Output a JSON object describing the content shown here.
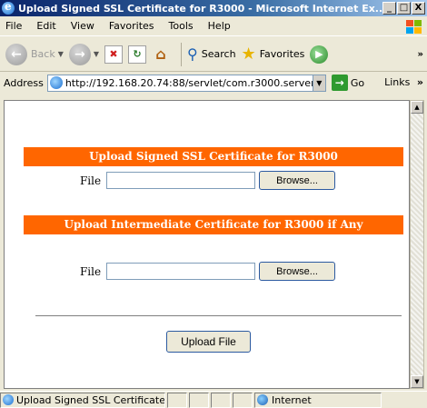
{
  "window": {
    "title": "Upload Signed SSL Certificate for R3000 - Microsoft Internet Ex...",
    "controls": {
      "minimize": "_",
      "maximize": "□",
      "close": "X"
    }
  },
  "menu": [
    "File",
    "Edit",
    "View",
    "Favorites",
    "Tools",
    "Help"
  ],
  "toolbar": {
    "back_label": "Back",
    "search_label": "Search",
    "favorites_label": "Favorites",
    "overflow": "»"
  },
  "address": {
    "label": "Address",
    "url": "http://192.168.20.74:88/servlet/com.r3000.server",
    "go_label": "Go",
    "links_label": "Links",
    "links_chevron": "»"
  },
  "page": {
    "section1_title": "Upload Signed SSL Certificate for R3000",
    "section1_file_label": "File",
    "section1_file_value": "",
    "section1_browse_label": "Browse...",
    "section2_title": "Upload Intermediate Certificate for R3000 if Any",
    "section2_file_label": "File",
    "section2_file_value": "",
    "section2_browse_label": "Browse...",
    "upload_label": "Upload File"
  },
  "status": {
    "text": "Upload Signed SSL Certificate f",
    "zone": "Internet"
  },
  "colors": {
    "header_orange": "#ff6600",
    "titlebar_blue": "#0a246a"
  }
}
